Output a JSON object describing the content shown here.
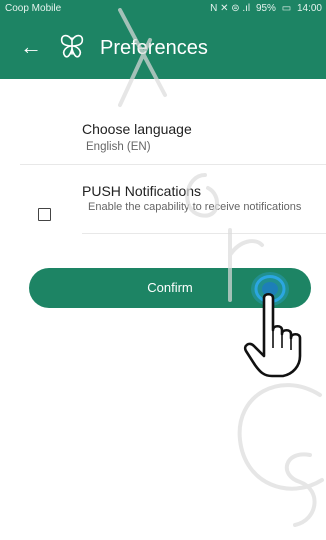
{
  "status_bar": {
    "carrier": "Coop Mobile",
    "indicators": "N ✕ ⊜ .ıl",
    "battery": "95%",
    "time": "14:00"
  },
  "app_bar": {
    "title": "Preferences",
    "back_icon": "arrow-left",
    "logo_icon": "butterfly-logo"
  },
  "preferences": {
    "language": {
      "title": "Choose language",
      "value": "English (EN)"
    },
    "push": {
      "title": "PUSH Notifications",
      "description": "Enable the capability to receive notifications",
      "checked": false
    }
  },
  "actions": {
    "confirm_label": "Confirm"
  },
  "colors": {
    "primary": "#1d8464",
    "tap_highlight": "#2ba6e0"
  }
}
